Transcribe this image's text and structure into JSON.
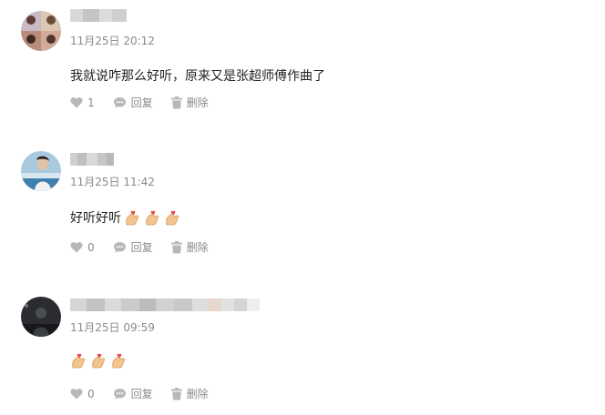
{
  "comments": [
    {
      "timestamp": "11月25日 20:12",
      "text": "我就说咋那么好听，原来又是张超师傅作曲了",
      "emoji_count": 0,
      "like_count": "1",
      "reply_label": "回复",
      "delete_label": "删除"
    },
    {
      "timestamp": "11月25日 11:42",
      "text": "好听好听",
      "emoji_count": 3,
      "like_count": "0",
      "reply_label": "回复",
      "delete_label": "删除"
    },
    {
      "timestamp": "11月25日 09:59",
      "text": "",
      "emoji_count": 3,
      "like_count": "0",
      "reply_label": "回复",
      "delete_label": "删除"
    }
  ],
  "icons": {
    "like": "heart-icon",
    "reply": "comment-bubble-icon",
    "delete": "trash-icon",
    "emoji": "finger-heart-emoji"
  },
  "colors": {
    "meta_text": "#8a8a8a",
    "body_text": "#222222"
  }
}
